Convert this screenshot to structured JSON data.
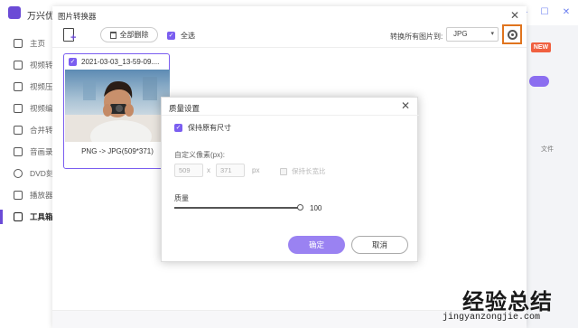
{
  "app": {
    "title": "万兴优",
    "sidebar": [
      {
        "label": "主页",
        "active": false
      },
      {
        "label": "视频转",
        "active": false
      },
      {
        "label": "视频压",
        "active": false
      },
      {
        "label": "视频编",
        "active": false
      },
      {
        "label": "合并转",
        "active": false
      },
      {
        "label": "音画录",
        "active": false
      },
      {
        "label": "DVD刻",
        "active": false
      },
      {
        "label": "播放器",
        "active": false
      },
      {
        "label": "工具箱",
        "active": true
      }
    ],
    "new_badge": "NEW",
    "right_text": "文件"
  },
  "converter": {
    "title": "图片转换器",
    "toolbar": {
      "delete_all": "全部删除",
      "select_all": "全选",
      "convert_all_label": "转换所有图片到:",
      "format": "JPG"
    },
    "item": {
      "name": "2021-03-03_13-59-09....",
      "info": "PNG -> JPG(509*371)"
    }
  },
  "dialog": {
    "title": "质量设置",
    "keep_size": "保持原有尺寸",
    "custom_label": "自定义像素(px):",
    "width": "509",
    "x": "x",
    "height": "371",
    "px": "px",
    "keep_ratio": "保持长宽比",
    "quality_label": "质量",
    "quality_value": "100",
    "ok": "确定",
    "cancel": "取消"
  },
  "watermark": {
    "cn": "经验总结",
    "url": "jingyanzongjie.com"
  },
  "colors": {
    "accent": "#7b5ef0",
    "highlight": "#e0741e"
  }
}
